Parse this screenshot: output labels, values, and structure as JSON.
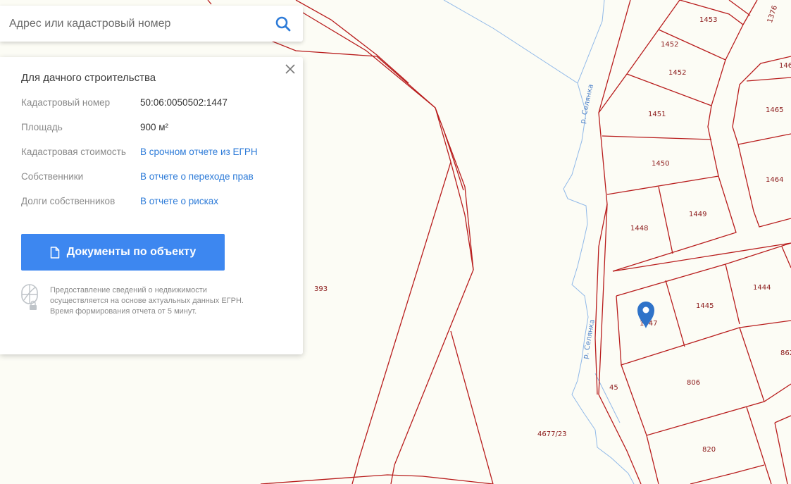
{
  "search": {
    "placeholder": "Адрес или кадастровый номер",
    "icon": "search-icon"
  },
  "card": {
    "title": "Для дачного строительства",
    "rows": [
      {
        "label": "Кадастровый номер",
        "value": "50:06:0050502:1447"
      },
      {
        "label": "Площадь",
        "value": "900 м²"
      },
      {
        "label": "Кадастровая стоимость",
        "value": "В срочном отчете из ЕГРН"
      },
      {
        "label": "Собственники",
        "value": "В отчете о переходе прав"
      },
      {
        "label": "Долги собственников",
        "value": "В отчете о рисках"
      }
    ],
    "button_label": "Документы по объекту",
    "info_text": "Предоставление сведений о недвижимости осуществляется на основе актуальных данных ЕГРН. Время формирования отчета от 5 минут."
  },
  "map": {
    "parcel_labels": [
      "1453",
      "1376",
      "1452",
      "1452",
      "146",
      "1451",
      "1465",
      "1450",
      "1464",
      "1449",
      "1448",
      "1444",
      "1445",
      "1447",
      "862",
      "806",
      "45",
      "393",
      "4677/23",
      "820"
    ],
    "river_labels": [
      "р. Селянка",
      "р. Селянка"
    ],
    "marker_icon": "map-pin-icon"
  },
  "colors": {
    "accent": "#3d87f0",
    "link": "#2d7bd8",
    "boundary": "#b81c1c",
    "water": "#8fb8e8",
    "map_background": "#fcfcf5"
  }
}
